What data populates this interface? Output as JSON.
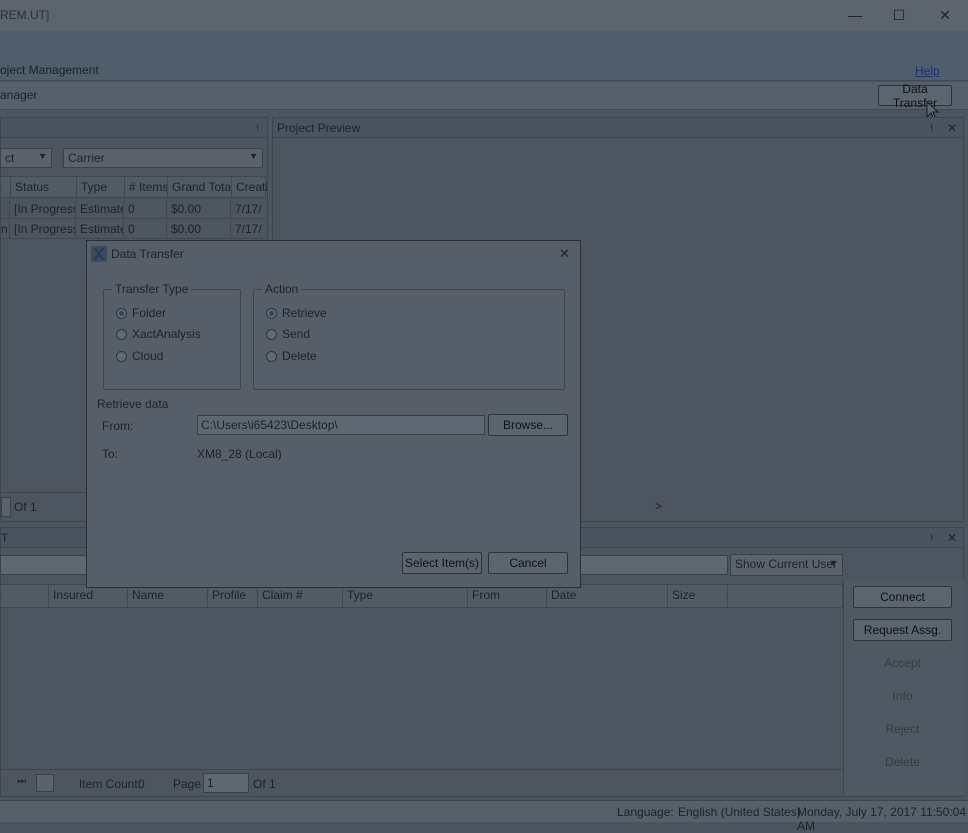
{
  "window": {
    "title": "REM.UT]",
    "controls": {
      "minimize": "—",
      "maximize": "☐",
      "close": "✕"
    }
  },
  "menu": {
    "project_management": "oject Management",
    "help": "Help"
  },
  "subbar": {
    "manager_label": "anager",
    "data_transfer": "Data Transfer"
  },
  "left_panel": {
    "pin": "ᚬ",
    "filter1": "ct",
    "filter2": "Carrier",
    "columns": [
      "Status",
      "Type",
      "# Items",
      "Grand Total",
      "Creati"
    ],
    "rows": [
      {
        "c0": "",
        "status": "[In Progress]",
        "type": "Estimate",
        "items": "0",
        "total": "$0.00",
        "created": "7/17/"
      },
      {
        "c0": "n",
        "status": "[In Progress]",
        "type": "Estimate",
        "items": "0",
        "total": "$0.00",
        "created": "7/17/"
      }
    ],
    "pager_of": "Of 1"
  },
  "preview_panel": {
    "title": "Project Preview",
    "pin": "ᚬ",
    "close": "✕",
    "next": ">"
  },
  "bottom_panel": {
    "title_fragment": "T",
    "pin": "ᚬ",
    "close": "✕",
    "user_filter": "Show Current User",
    "columns": [
      "Insured",
      "Name",
      "Profile",
      "Claim #",
      "Type",
      "From",
      "Date",
      "Size"
    ],
    "actions": {
      "connect": "Connect",
      "request": "Request Assg.",
      "accept": "Accept",
      "info": "Info",
      "reject": "Reject",
      "delete": "Delete"
    },
    "pager": {
      "last": "⏭",
      "item_count_label": "Item Count:",
      "item_count": "0",
      "page_label": "Page",
      "page_value": "1",
      "of": "Of 1"
    }
  },
  "status": {
    "language_label": "Language:",
    "language": "English (United States)",
    "datetime": "Monday, July 17, 2017 11:50:04 AM"
  },
  "dialog": {
    "title": "Data Transfer",
    "close": "✕",
    "transfer_type": {
      "label": "Transfer Type",
      "options": [
        "Folder",
        "XactAnalysis",
        "Cloud"
      ],
      "selected": "Folder"
    },
    "action": {
      "label": "Action",
      "options": [
        "Retrieve",
        "Send",
        "Delete"
      ],
      "selected": "Retrieve"
    },
    "section_label": "Retrieve data",
    "from_label": "From:",
    "from_value": "C:\\Users\\i65423\\Desktop\\",
    "browse": "Browse...",
    "to_label": "To:",
    "to_value": "XM8_28 (Local)",
    "select_items": "Select Item(s)",
    "cancel": "Cancel"
  },
  "colors": {
    "overlay_bg": "#4b5560",
    "link": "#1b2f8a",
    "radio_dot": "#23466e"
  }
}
